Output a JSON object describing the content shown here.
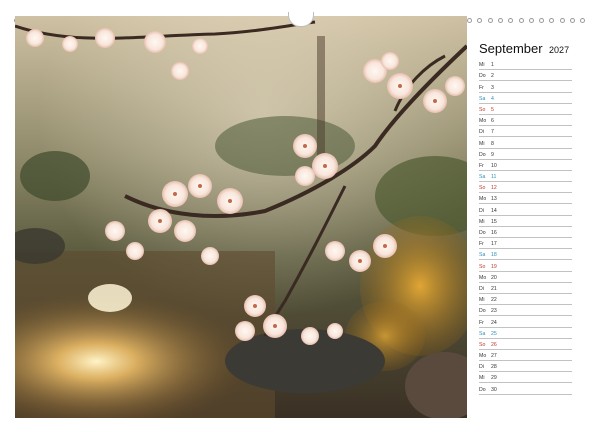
{
  "calendar": {
    "month": "September",
    "year": "2027",
    "days": [
      {
        "name": "Mi",
        "num": "1",
        "type": "weekday"
      },
      {
        "name": "Do",
        "num": "2",
        "type": "weekday"
      },
      {
        "name": "Fr",
        "num": "3",
        "type": "weekday"
      },
      {
        "name": "Sa",
        "num": "4",
        "type": "saturday"
      },
      {
        "name": "So",
        "num": "5",
        "type": "sunday"
      },
      {
        "name": "Mo",
        "num": "6",
        "type": "weekday"
      },
      {
        "name": "Di",
        "num": "7",
        "type": "weekday"
      },
      {
        "name": "Mi",
        "num": "8",
        "type": "weekday"
      },
      {
        "name": "Do",
        "num": "9",
        "type": "weekday"
      },
      {
        "name": "Fr",
        "num": "10",
        "type": "weekday"
      },
      {
        "name": "Sa",
        "num": "11",
        "type": "saturday"
      },
      {
        "name": "So",
        "num": "12",
        "type": "sunday"
      },
      {
        "name": "Mo",
        "num": "13",
        "type": "weekday"
      },
      {
        "name": "Di",
        "num": "14",
        "type": "weekday"
      },
      {
        "name": "Mi",
        "num": "15",
        "type": "weekday"
      },
      {
        "name": "Do",
        "num": "16",
        "type": "weekday"
      },
      {
        "name": "Fr",
        "num": "17",
        "type": "weekday"
      },
      {
        "name": "Sa",
        "num": "18",
        "type": "saturday"
      },
      {
        "name": "So",
        "num": "19",
        "type": "sunday"
      },
      {
        "name": "Mo",
        "num": "20",
        "type": "weekday"
      },
      {
        "name": "Di",
        "num": "21",
        "type": "weekday"
      },
      {
        "name": "Mi",
        "num": "22",
        "type": "weekday"
      },
      {
        "name": "Do",
        "num": "23",
        "type": "weekday"
      },
      {
        "name": "Fr",
        "num": "24",
        "type": "weekday"
      },
      {
        "name": "Sa",
        "num": "25",
        "type": "saturday"
      },
      {
        "name": "So",
        "num": "26",
        "type": "sunday"
      },
      {
        "name": "Mo",
        "num": "27",
        "type": "weekday"
      },
      {
        "name": "Di",
        "num": "28",
        "type": "weekday"
      },
      {
        "name": "Mi",
        "num": "29",
        "type": "weekday"
      },
      {
        "name": "Do",
        "num": "30",
        "type": "weekday"
      }
    ]
  },
  "colors": {
    "saturday": "#2f8fb5",
    "sunday": "#c0392b",
    "weekday": "#333333"
  }
}
